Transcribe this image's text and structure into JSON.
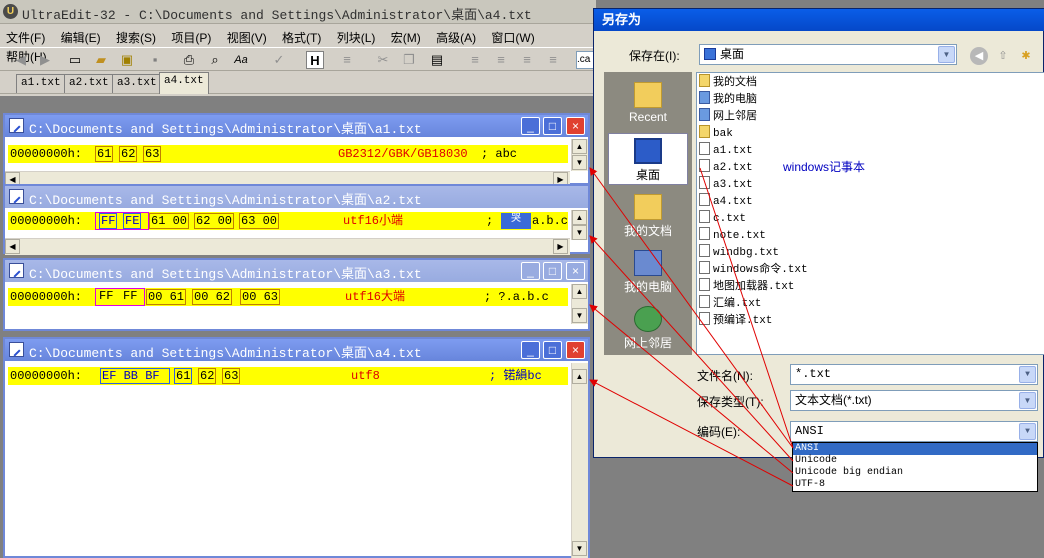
{
  "app": {
    "title": "UltraEdit-32 - C:\\Documents and Settings\\Administrator\\桌面\\a4.txt",
    "icon": "ultraedit-logo-icon"
  },
  "menu": [
    "文件(F)",
    "编辑(E)",
    "搜索(S)",
    "项目(P)",
    "视图(V)",
    "格式(T)",
    "列块(L)",
    "宏(M)",
    "高级(A)",
    "窗口(W)",
    "帮助(H)"
  ],
  "toolbar": {
    "h_label": "H",
    "aa_label": "Aa",
    "ca_label": ".ca"
  },
  "tabs": [
    "a1.txt",
    "a2.txt",
    "a3.txt",
    "a4.txt"
  ],
  "active_tab": "a4.txt",
  "windows": [
    {
      "title": "C:\\Documents and Settings\\Administrator\\桌面\\a1.txt",
      "offset": "00000000h:",
      "bom": [],
      "bytes": [
        "61",
        "62",
        "63"
      ],
      "note": "GB2312/GBK/GB18030",
      "ascii": "; abc"
    },
    {
      "title": "C:\\Documents and Settings\\Administrator\\桌面\\a2.txt",
      "offset": "00000000h:",
      "bom": [
        "FF",
        "FE"
      ],
      "bytes": [
        "61 00",
        "62 00",
        "63 00"
      ],
      "note": "utf16小端",
      "ascii": ";",
      "ascii_tail": "a.b.c",
      "ascii_sel": "哭"
    },
    {
      "title": "C:\\Documents and Settings\\Administrator\\桌面\\a3.txt",
      "offset": "00000000h:",
      "bom": [
        "FF",
        "FF"
      ],
      "bytes": [
        "00 61",
        "00 62",
        "00 63"
      ],
      "note": "utf16大端",
      "ascii": "; ?.a.b.c"
    },
    {
      "title": "C:\\Documents and Settings\\Administrator\\桌面\\a4.txt",
      "offset": "00000000h:",
      "bom": [
        "EF",
        "BB",
        "BF"
      ],
      "bytes": [
        "61",
        "62",
        "63"
      ],
      "note": "utf8",
      "ascii": "; 锘縜bc"
    }
  ],
  "caption_buttons": {
    "minimize": "_",
    "maximize": "□",
    "close": "×"
  },
  "save_dialog": {
    "title": "另存为",
    "save_in_label": "保存在(I):",
    "save_in_value": "桌面",
    "places": [
      "Recent",
      "桌面",
      "我的文档",
      "我的电脑",
      "网上邻居"
    ],
    "active_place": "桌面",
    "files": [
      {
        "name": "我的文档",
        "icon": "folder-icon"
      },
      {
        "name": "我的电脑",
        "icon": "computer-icon"
      },
      {
        "name": "网上邻居",
        "icon": "network-icon"
      },
      {
        "name": "bak",
        "icon": "folder-icon"
      },
      {
        "name": "a1.txt",
        "icon": "text-file-icon"
      },
      {
        "name": "a2.txt",
        "icon": "text-file-icon"
      },
      {
        "name": "a3.txt",
        "icon": "text-file-icon"
      },
      {
        "name": "a4.txt",
        "icon": "text-file-icon"
      },
      {
        "name": "c.txt",
        "icon": "text-file-icon"
      },
      {
        "name": "note.txt",
        "icon": "text-file-icon"
      },
      {
        "name": "windbg.txt",
        "icon": "text-file-icon"
      },
      {
        "name": "windows命令.txt",
        "icon": "text-file-icon"
      },
      {
        "name": "地图加载器.txt",
        "icon": "text-file-icon"
      },
      {
        "name": "汇编.txt",
        "icon": "text-file-icon"
      },
      {
        "name": "预编译.txt",
        "icon": "text-file-icon"
      }
    ],
    "annotation": "windows记事本",
    "filename_label": "文件名(N):",
    "filename_value": "*.txt",
    "filetype_label": "保存类型(T):",
    "filetype_value": "文本文档(*.txt)",
    "encoding_label": "编码(E):",
    "encoding_value": "ANSI",
    "encoding_options": [
      "ANSI",
      "Unicode",
      "Unicode big endian",
      "UTF-8"
    ],
    "encoding_highlighted": "ANSI"
  },
  "colors": {
    "hex_background": "#ffff00",
    "annotation_red": "#e00000",
    "annotation_blue": "#0000c0",
    "title_gradient": "#6785dc",
    "dialog_title": "#0548c8",
    "arrow_red": "#e00000"
  }
}
